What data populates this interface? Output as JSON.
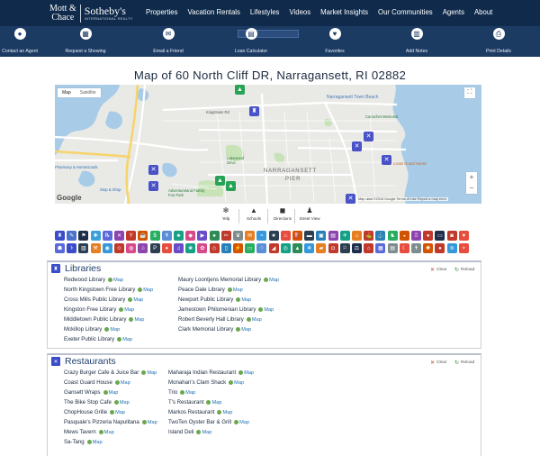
{
  "brand": {
    "line1": "Mott &",
    "line2": "Chace",
    "name": "Sotheby's",
    "tagline": "INTERNATIONAL REALTY"
  },
  "nav": [
    "Properties",
    "Vacation Rentals",
    "Lifestyles",
    "Videos",
    "Market Insights",
    "Our Communities",
    "Agents",
    "About"
  ],
  "actions": [
    {
      "label": "Contact an Agent",
      "icon": "user-icon",
      "glyph": "●"
    },
    {
      "label": "Request a Showing",
      "icon": "calendar-icon",
      "glyph": "▦"
    },
    {
      "label": "Email a Friend",
      "icon": "envelope-icon",
      "glyph": "✉"
    },
    {
      "label": "Loan Calculator",
      "icon": "calculator-icon",
      "glyph": "▤"
    },
    {
      "label": "Favorites",
      "icon": "heart-icon",
      "glyph": "♥"
    },
    {
      "label": "Add Notes",
      "icon": "notes-icon",
      "glyph": "▥"
    },
    {
      "label": "Print Details",
      "icon": "printer-icon",
      "glyph": "⎙"
    }
  ],
  "title": "Map of 60 North Cliff DR, Narragansett, RI 02882",
  "map": {
    "tab_map": "Map",
    "tab_satellite": "Satellite",
    "google": "Google",
    "attribution": "Map data ©2018 Google   Terms of Use   Report a map error",
    "labels": {
      "kingstown": "Kingstown Rd",
      "narr_town_beach": "Narragansett Town Beach",
      "canochet": "Canochet Memorial",
      "coast_guard": "Coast Guard House",
      "narragansett": "NARRAGANSETT",
      "pier": "PIER",
      "lakewood": "Lakewood Drive",
      "adventureland": "Adventureland Family Fun Park",
      "stop_shop": "Stop & Shop",
      "pharmacy": "Pharmacy & HomeGoods",
      "fleet": "Fleet Rd"
    }
  },
  "tools": [
    {
      "label": "Yelp",
      "icon": "yelp-icon",
      "glyph": "✻"
    },
    {
      "label": "Schools",
      "icon": "school-icon",
      "glyph": "▲"
    },
    {
      "label": "Directions",
      "icon": "car-icon",
      "glyph": "◼"
    },
    {
      "label": "Street View",
      "icon": "pegman-icon",
      "glyph": "♟"
    }
  ],
  "categories_row1": [
    {
      "n": "library",
      "c": "#3a4cc8",
      "g": "♜"
    },
    {
      "n": "school",
      "c": "#4a72c8",
      "g": "✎"
    },
    {
      "n": "ferry",
      "c": "#1e2e4a",
      "g": "⚑"
    },
    {
      "n": "hospital",
      "c": "#3ba0d8",
      "g": "✚"
    },
    {
      "n": "pharmacy",
      "c": "#5a6ad8",
      "g": "℞"
    },
    {
      "n": "restaurant",
      "c": "#8e44ad",
      "g": "✕"
    },
    {
      "n": "bar",
      "c": "#c0392b",
      "g": "Y"
    },
    {
      "n": "coffee",
      "c": "#d35400",
      "g": "☕"
    },
    {
      "n": "bank",
      "c": "#27ae60",
      "g": "$"
    },
    {
      "n": "church",
      "c": "#5a8fd8",
      "g": "✝"
    },
    {
      "n": "gym",
      "c": "#16a085",
      "g": "♣"
    },
    {
      "n": "shopping",
      "c": "#d64a8a",
      "g": "◆"
    },
    {
      "n": "cinema",
      "c": "#6a4cc8",
      "g": "▶"
    },
    {
      "n": "park",
      "c": "#2e8b57",
      "g": "♠"
    },
    {
      "n": "salon",
      "c": "#c0392b",
      "g": "✂"
    },
    {
      "n": "museum",
      "c": "#7f8c8d",
      "g": "♛"
    },
    {
      "n": "post",
      "c": "#e67e22",
      "g": "✉"
    },
    {
      "n": "beach",
      "c": "#3498db",
      "g": "≈"
    },
    {
      "n": "police",
      "c": "#2c3e50",
      "g": "★"
    },
    {
      "n": "fire",
      "c": "#e74c3c",
      "g": "♨"
    },
    {
      "n": "gas",
      "c": "#d35400",
      "g": "⛽"
    },
    {
      "n": "car",
      "c": "#2c3e50",
      "g": "▬"
    },
    {
      "n": "bus",
      "c": "#2980b9",
      "g": "▣"
    },
    {
      "n": "train",
      "c": "#8e44ad",
      "g": "▤"
    },
    {
      "n": "airport",
      "c": "#16a085",
      "g": "✈"
    },
    {
      "n": "hotel",
      "c": "#e67e22",
      "g": "⌂"
    },
    {
      "n": "golf",
      "c": "#c0392b",
      "g": "⛳"
    },
    {
      "n": "marina",
      "c": "#2980b9",
      "g": "⚓"
    },
    {
      "n": "zoo",
      "c": "#27ae60",
      "g": "♞"
    },
    {
      "n": "bakery",
      "c": "#d35400",
      "g": "◒"
    },
    {
      "n": "liquor",
      "c": "#8e44ad",
      "g": "♖"
    },
    {
      "n": "grocery",
      "c": "#c0392b",
      "g": "●"
    },
    {
      "n": "atm",
      "c": "#1e2e4a",
      "g": "▭"
    },
    {
      "n": "laundry",
      "c": "#c0392b",
      "g": "◙"
    },
    {
      "n": "vet",
      "c": "#e74c3c",
      "g": "♥"
    }
  ],
  "categories_row2": [
    {
      "n": "dentist",
      "c": "#5a6ad8",
      "g": "☗"
    },
    {
      "n": "doctor",
      "c": "#3a4cc8",
      "g": "⚕"
    },
    {
      "n": "store",
      "c": "#2c3e50",
      "g": "▥"
    },
    {
      "n": "hardware",
      "c": "#e67e22",
      "g": "⚒"
    },
    {
      "n": "aquarium",
      "c": "#3498db",
      "g": "◉"
    },
    {
      "n": "theater",
      "c": "#c0392b",
      "g": "☺"
    },
    {
      "n": "stadium",
      "c": "#d64a8a",
      "g": "◍"
    },
    {
      "n": "pet",
      "c": "#8e44ad",
      "g": "♧"
    },
    {
      "n": "parking",
      "c": "#2c3e50",
      "g": "P"
    },
    {
      "n": "casino",
      "c": "#e74c3c",
      "g": "♦"
    },
    {
      "n": "nightclub",
      "c": "#6a4cc8",
      "g": "♫"
    },
    {
      "n": "spa",
      "c": "#16a085",
      "g": "❀"
    },
    {
      "n": "florist",
      "c": "#d64a8a",
      "g": "✿"
    },
    {
      "n": "jewelry",
      "c": "#c0392b",
      "g": "◇"
    },
    {
      "n": "books",
      "c": "#2980b9",
      "g": "▯"
    },
    {
      "n": "electronics",
      "c": "#d35400",
      "g": "⚡"
    },
    {
      "n": "furniture",
      "c": "#27ae60",
      "g": "▭"
    },
    {
      "n": "clothing",
      "c": "#5a8fd8",
      "g": "♢"
    },
    {
      "n": "shoes",
      "c": "#c0392b",
      "g": "◢"
    },
    {
      "n": "bike",
      "c": "#16a085",
      "g": "◎"
    },
    {
      "n": "camp",
      "c": "#2e8b57",
      "g": "▲"
    },
    {
      "n": "ski",
      "c": "#3498db",
      "g": "❄"
    },
    {
      "n": "taxi",
      "c": "#e67e22",
      "g": "▰"
    },
    {
      "n": "subway",
      "c": "#c0392b",
      "g": "◘"
    },
    {
      "n": "embassy",
      "c": "#2c3e50",
      "g": "⚐"
    },
    {
      "n": "courthouse",
      "c": "#1e2e4a",
      "g": "⚖"
    },
    {
      "n": "cityhall",
      "c": "#c0392b",
      "g": "⌂"
    },
    {
      "n": "storage",
      "c": "#5a6ad8",
      "g": "▦"
    },
    {
      "n": "moving",
      "c": "#7f8c8d",
      "g": "▤"
    },
    {
      "n": "lodging",
      "c": "#e74c3c",
      "g": "☾"
    },
    {
      "n": "cemetery",
      "c": "#7f8c8d",
      "g": "✝"
    },
    {
      "n": "amusement",
      "c": "#d35400",
      "g": "✺"
    },
    {
      "n": "bowling",
      "c": "#c0392b",
      "g": "●"
    },
    {
      "n": "carwash",
      "c": "#3498db",
      "g": "≋"
    },
    {
      "n": "repair",
      "c": "#e74c3c",
      "g": "✧"
    }
  ],
  "libraries": {
    "title": "Libraries",
    "clear": "Clear",
    "reload": "Reload",
    "map_link": "Map",
    "col1": [
      "Redwood Library",
      "North Kingstown Free Library",
      "Cross Mills Public Library",
      "Kingston Free Library",
      "Middletown Public Library",
      "Mckillop Library",
      "Exeter Public Library"
    ],
    "col2": [
      "Maury Loontjens Memorial Library",
      "Peace Dale Library",
      "Newport Public Library",
      "Jamestown Philomenian Library",
      "Robert Beverly Hall Library",
      "Clark Memorial Library"
    ]
  },
  "restaurants": {
    "title": "Restaurants",
    "clear": "Clear",
    "reload": "Reload",
    "map_link": "Map",
    "col1": [
      "Crazy Burger Cafe & Juice Bar",
      "Coast Guard House",
      "Gansett Wraps",
      "The Bike Stop Cafe",
      "ChopHouse Grille",
      "Pasquale's Pizzeria Napulitana",
      "Mews Tavern",
      "Sa-Tang"
    ],
    "col2": [
      "Maharaja Indian Restaurant",
      "Monahan's Clam Shack",
      "Trio",
      "T's Restaurant",
      "Markos Restaurant",
      "TwoTen Oyster Bar & Grill",
      "Island Deli"
    ]
  }
}
